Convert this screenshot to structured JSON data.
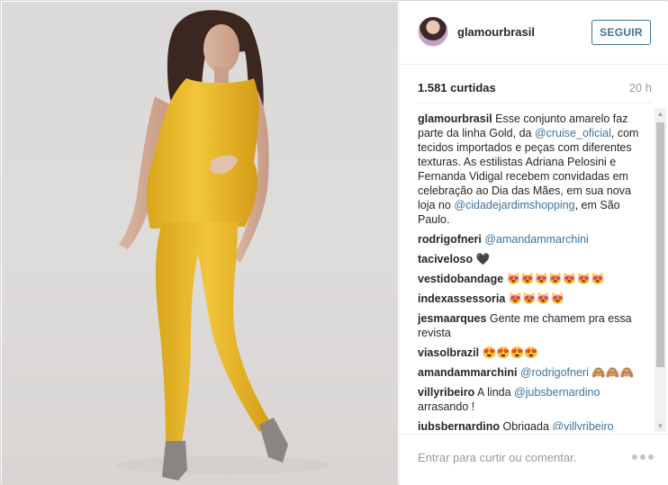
{
  "post": {
    "username": "glamourbrasil",
    "follow_label": "SEGUIR",
    "likes": "1.581 curtidas",
    "time": "20 h"
  },
  "comments": [
    {
      "author": "glamourbrasil",
      "parts": [
        "Esse conjunto amarelo faz parte da linha Gold, da ",
        "@cruise_oficial",
        ", com tecidos importados e peças com diferentes texturas. As estilistas Adriana Pelosini e Fernanda Vidigal recebem convidadas em celebração ao Dia das Mães, em sua nova loja no ",
        "@cidadejardimshopping",
        ", em São Paulo."
      ]
    },
    {
      "author": "rodrigofneri",
      "mention": "@amandammarchini"
    },
    {
      "author": "taciveloso",
      "text": "🖤"
    },
    {
      "author": "vestidobandage",
      "text": "😻😻😻😻😻😻😻"
    },
    {
      "author": "indexassessoria",
      "text": "😻😻😻😻"
    },
    {
      "author": "jesmaarques",
      "text": "Gente me chamem pra essa revista"
    },
    {
      "author": "viasolbrazil",
      "text": "😍😍😍😍"
    },
    {
      "author": "amandammarchini",
      "mention": "@rodrigofneri",
      "text": "🙈🙈🙈"
    },
    {
      "author": "villyribeiro",
      "text": "A linda ",
      "mention": "@jubsbernardino",
      "text2": "arrasando !"
    },
    {
      "author": "jubsbernardino",
      "text": "Obrigada ",
      "mention": "@villyribeiro"
    }
  ],
  "footer": {
    "comment_placeholder": "Entrar para curtir ou comentar."
  },
  "icons": {
    "more": "more-options-icon",
    "scroll_up": "scroll-up-arrow",
    "scroll_down": "scroll-down-arrow"
  },
  "colors": {
    "link": "#3f729b",
    "text": "#262626",
    "muted": "#999999"
  }
}
